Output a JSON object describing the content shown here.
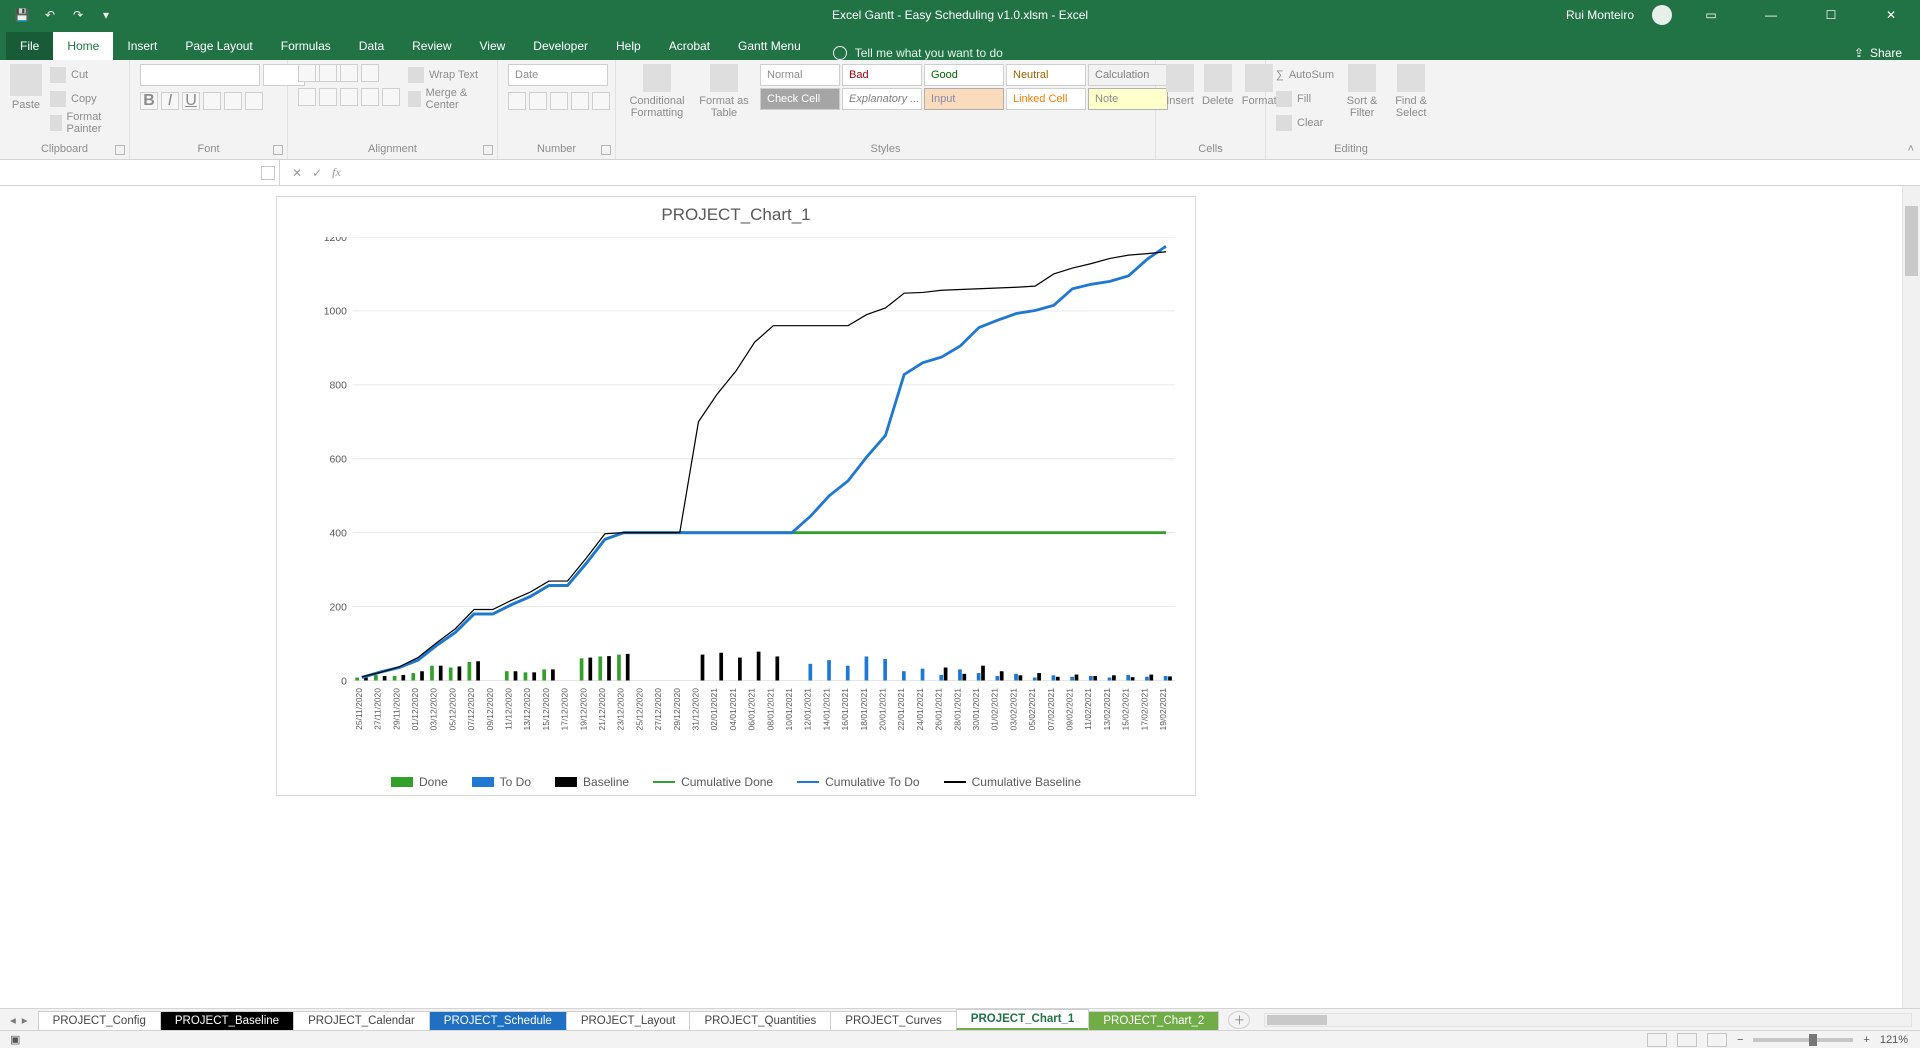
{
  "app": {
    "title": "Excel Gantt - Easy Scheduling v1.0.xlsm  -  Excel",
    "user": "Rui Monteiro"
  },
  "ribbon_tabs": [
    "File",
    "Home",
    "Insert",
    "Page Layout",
    "Formulas",
    "Data",
    "Review",
    "View",
    "Developer",
    "Help",
    "Acrobat",
    "Gantt Menu"
  ],
  "tell_me": "Tell me what you want to do",
  "share": "Share",
  "clipboard": {
    "label": "Clipboard",
    "paste": "Paste",
    "cut": "Cut",
    "copy": "Copy",
    "fmt": "Format Painter"
  },
  "font": {
    "label": "Font"
  },
  "alignment": {
    "label": "Alignment",
    "wrap": "Wrap Text",
    "merge": "Merge & Center"
  },
  "number": {
    "label": "Number",
    "format": "Date"
  },
  "styles": {
    "label": "Styles",
    "cond": "Conditional Formatting",
    "table": "Format as Table",
    "cells": [
      "Normal",
      "Bad",
      "Good",
      "Neutral",
      "Calculation",
      "Check Cell",
      "Explanatory ...",
      "Input",
      "Linked Cell",
      "Note"
    ]
  },
  "cells": {
    "label": "Cells",
    "insert": "Insert",
    "delete": "Delete",
    "format": "Format"
  },
  "editing": {
    "label": "Editing",
    "autosum": "AutoSum",
    "fill": "Fill",
    "clear": "Clear",
    "sort": "Sort & Filter",
    "find": "Find & Select"
  },
  "sheets": [
    "PROJECT_Config",
    "PROJECT_Baseline",
    "PROJECT_Calendar",
    "PROJECT_Schedule",
    "PROJECT_Layout",
    "PROJECT_Quantities",
    "PROJECT_Curves",
    "PROJECT_Chart_1",
    "PROJECT_Chart_2"
  ],
  "status_zoom": "121%",
  "chart_data": {
    "type": "combo",
    "title": "PROJECT_Chart_1",
    "ylim": [
      0,
      1200
    ],
    "yticks": [
      0,
      200,
      400,
      600,
      800,
      1000,
      1200
    ],
    "categories": [
      "25/11/2020",
      "27/11/2020",
      "29/11/2020",
      "01/12/2020",
      "03/12/2020",
      "05/12/2020",
      "07/12/2020",
      "09/12/2020",
      "11/12/2020",
      "13/12/2020",
      "15/12/2020",
      "17/12/2020",
      "19/12/2020",
      "21/12/2020",
      "23/12/2020",
      "25/12/2020",
      "27/12/2020",
      "29/12/2020",
      "31/12/2020",
      "02/01/2021",
      "04/01/2021",
      "06/01/2021",
      "08/01/2021",
      "10/01/2021",
      "12/01/2021",
      "14/01/2021",
      "16/01/2021",
      "18/01/2021",
      "20/01/2021",
      "22/01/2021",
      "24/01/2021",
      "26/01/2021",
      "28/01/2021",
      "30/01/2021",
      "01/02/2021",
      "03/02/2021",
      "05/02/2021",
      "07/02/2021",
      "09/02/2021",
      "11/02/2021",
      "13/02/2021",
      "15/02/2021",
      "17/02/2021",
      "19/02/2021"
    ],
    "series": [
      {
        "name": "Done",
        "type": "bar",
        "color": "#33a02c",
        "values": [
          8,
          15,
          12,
          20,
          40,
          35,
          50,
          0,
          25,
          22,
          30,
          0,
          60,
          65,
          70,
          0,
          0,
          0,
          0,
          0,
          0,
          0,
          0,
          0,
          0,
          0,
          0,
          0,
          0,
          0,
          0,
          0,
          0,
          0,
          0,
          0,
          0,
          0,
          0,
          0,
          0,
          0,
          0,
          0
        ]
      },
      {
        "name": "To Do",
        "type": "bar",
        "color": "#1f78d1",
        "values": [
          0,
          0,
          0,
          0,
          0,
          0,
          0,
          0,
          0,
          0,
          0,
          0,
          0,
          0,
          0,
          0,
          0,
          0,
          0,
          0,
          0,
          0,
          0,
          0,
          45,
          55,
          40,
          65,
          58,
          25,
          32,
          15,
          30,
          20,
          12,
          18,
          8,
          14,
          10,
          12,
          8,
          15,
          10,
          12
        ]
      },
      {
        "name": "Baseline",
        "type": "bar",
        "color": "#000000",
        "values": [
          10,
          12,
          15,
          25,
          40,
          38,
          52,
          0,
          25,
          22,
          30,
          0,
          62,
          66,
          72,
          0,
          0,
          0,
          70,
          75,
          62,
          78,
          65,
          0,
          0,
          0,
          0,
          0,
          0,
          0,
          0,
          35,
          18,
          40,
          25,
          14,
          20,
          10,
          16,
          12,
          14,
          9,
          16,
          11
        ]
      },
      {
        "name": "Cumulative Done",
        "type": "line",
        "color": "#33a02c",
        "weight": 3,
        "values": [
          8,
          23,
          35,
          55,
          95,
          130,
          180,
          180,
          205,
          227,
          257,
          257,
          317,
          382,
          400,
          400,
          400,
          400,
          400,
          400,
          400,
          400,
          400,
          400,
          400,
          400,
          400,
          400,
          400,
          400,
          400,
          400,
          400,
          400,
          400,
          400,
          400,
          400,
          400,
          400,
          400,
          400,
          400,
          400
        ]
      },
      {
        "name": "Cumulative To Do",
        "type": "line",
        "color": "#1f78d1",
        "weight": 3,
        "values": [
          8,
          23,
          35,
          55,
          95,
          130,
          180,
          180,
          205,
          227,
          257,
          257,
          317,
          382,
          400,
          400,
          400,
          400,
          400,
          400,
          400,
          400,
          400,
          400,
          445,
          500,
          540,
          605,
          663,
          828,
          860,
          875,
          905,
          955,
          975,
          993,
          1001,
          1015,
          1060,
          1072,
          1080,
          1095,
          1140,
          1175
        ]
      },
      {
        "name": "Cumulative Baseline",
        "type": "line",
        "color": "#000000",
        "weight": 1.3,
        "values": [
          10,
          22,
          37,
          62,
          102,
          140,
          192,
          192,
          217,
          239,
          269,
          269,
          331,
          397,
          400,
          400,
          400,
          400,
          700,
          775,
          837,
          915,
          960,
          960,
          960,
          960,
          960,
          990,
          1008,
          1048,
          1050,
          1056,
          1058,
          1060,
          1062,
          1064,
          1067,
          1100,
          1116,
          1128,
          1142,
          1151,
          1155,
          1160
        ]
      }
    ],
    "legend": [
      "Done",
      "To Do",
      "Baseline",
      "Cumulative Done",
      "Cumulative To Do",
      "Cumulative Baseline"
    ]
  }
}
